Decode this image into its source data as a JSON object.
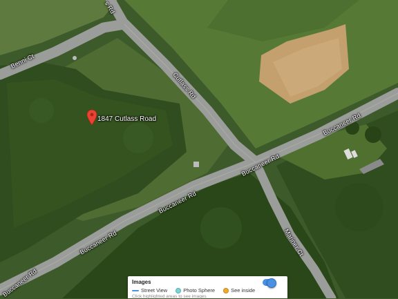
{
  "map": {
    "imagery": "satellite",
    "roads": [
      {
        "id": "s-rd",
        "label": "s Rd"
      },
      {
        "id": "benni-ct",
        "label": "Benni Ct"
      },
      {
        "id": "cutlass-rd",
        "label": "Cutlass Rd"
      },
      {
        "id": "buccaneer-rd-1",
        "label": "Buccaneer Rd"
      },
      {
        "id": "buccaneer-rd-2",
        "label": "Buccaneer Rd"
      },
      {
        "id": "buccaneer-rd-3",
        "label": "Buccaneer Rd"
      },
      {
        "id": "buccaneer-rd-4",
        "label": "Buccaneer Rd"
      },
      {
        "id": "buccaneer-rd-5",
        "label": "Buccaneer Rd"
      },
      {
        "id": "mariner-ct",
        "label": "Mariner Ct"
      }
    ],
    "place": {
      "label": "1847 Cutlass Road",
      "marker_color": "#ea4335"
    }
  },
  "legend": {
    "title": "Images",
    "items": [
      {
        "label": "Street View",
        "color": "#4a90e2",
        "icon": "line-icon"
      },
      {
        "label": "Photo Sphere",
        "color": "#7fd3d3",
        "icon": "dot-icon"
      },
      {
        "label": "See inside",
        "color": "#f0a830",
        "icon": "dot-icon"
      }
    ],
    "hint": "Click highlighted areas to see images",
    "toggle_on": true,
    "toggle_color": "#4a90e2"
  }
}
